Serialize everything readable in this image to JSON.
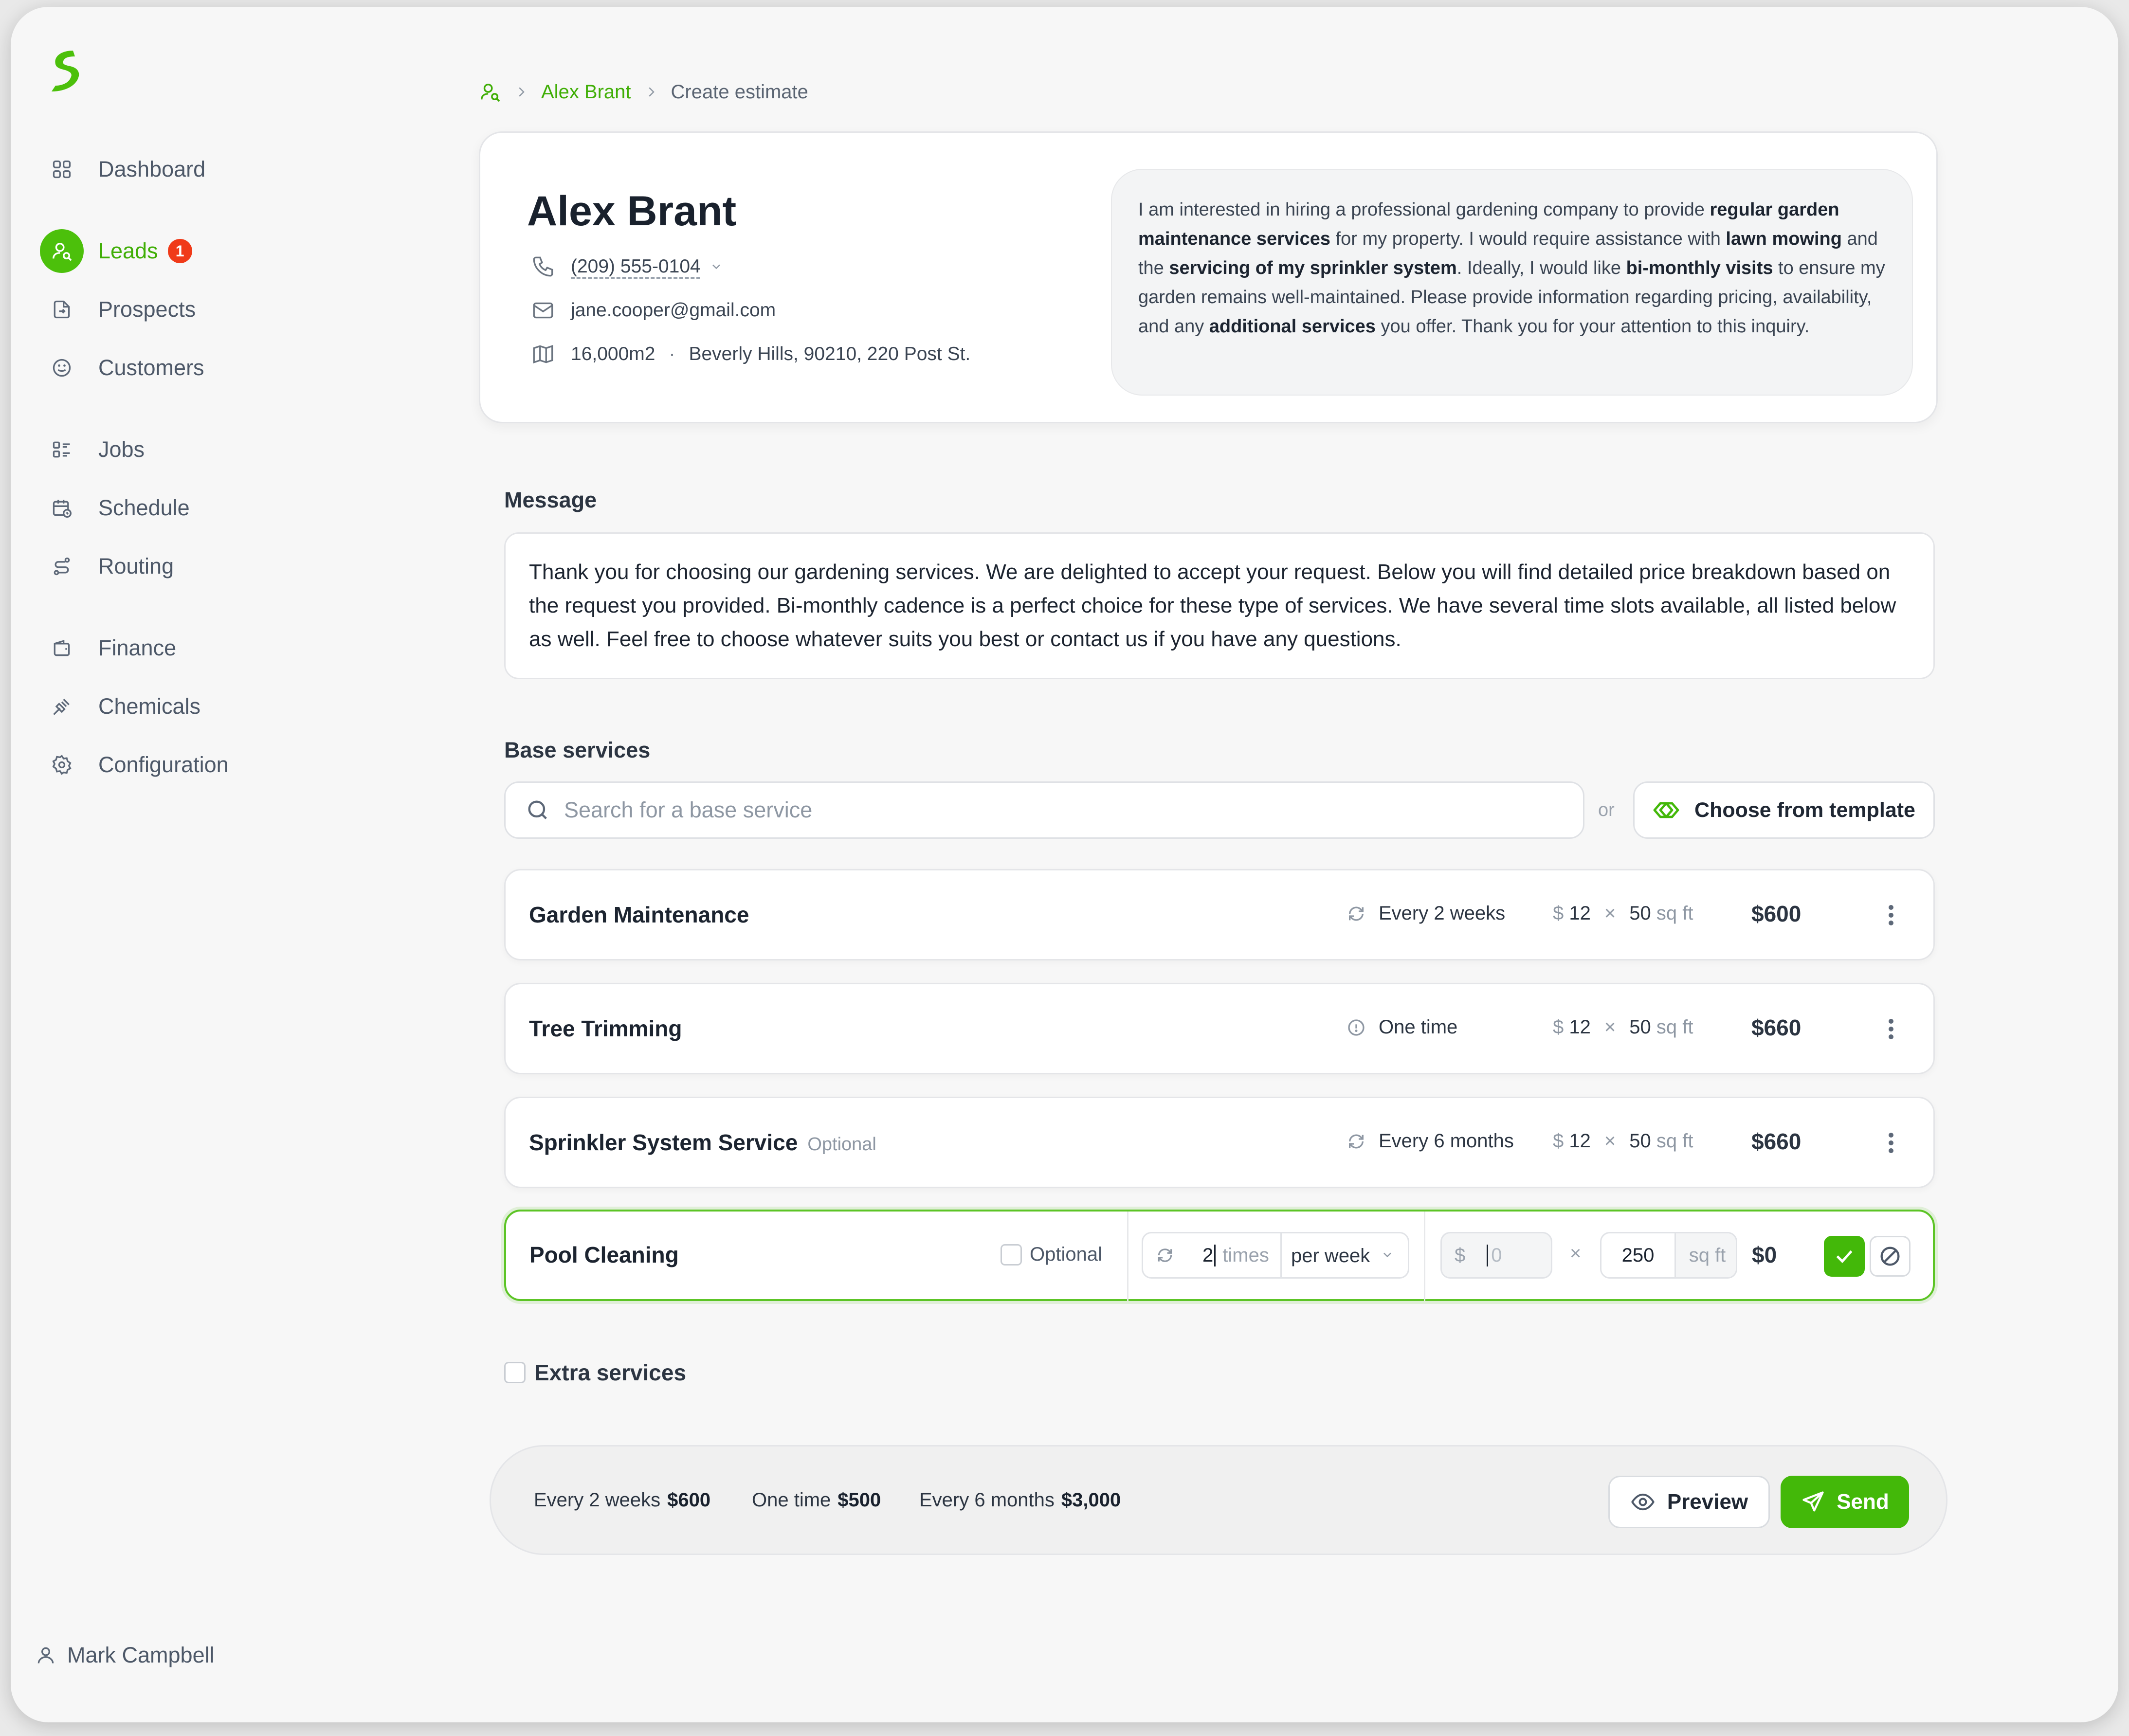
{
  "brand": {
    "accent": "#4cc00b",
    "badge_color": "#f03a19"
  },
  "sidebar": {
    "items": [
      {
        "label": "Dashboard",
        "icon": "grid-icon"
      },
      {
        "label": "Leads",
        "icon": "user-search-icon",
        "badge": "1",
        "active": true
      },
      {
        "label": "Prospects",
        "icon": "file-arrow-icon"
      },
      {
        "label": "Customers",
        "icon": "smiley-icon"
      },
      {
        "label": "Jobs",
        "icon": "list-icon"
      },
      {
        "label": "Schedule",
        "icon": "calendar-clock-icon"
      },
      {
        "label": "Routing",
        "icon": "route-icon"
      },
      {
        "label": "Finance",
        "icon": "wallet-icon"
      },
      {
        "label": "Chemicals",
        "icon": "spray-icon"
      },
      {
        "label": "Configuration",
        "icon": "gear-icon"
      }
    ],
    "user": "Mark Campbell"
  },
  "breadcrumb": {
    "parent": "Alex Brant",
    "current": "Create estimate"
  },
  "lead": {
    "name": "Alex Brant",
    "phone": "(209) 555-0104",
    "email": "jane.cooper@gmail.com",
    "area": "16,000m2",
    "address": "Beverly Hills, 90210, 220 Post St.",
    "request": [
      {
        "t": "I am interested in hiring a professional gardening company to provide "
      },
      {
        "t": "regular garden maintenance services",
        "b": true
      },
      {
        "t": " for my property. I would require assistance with "
      },
      {
        "t": "lawn mowing",
        "b": true
      },
      {
        "t": " and the "
      },
      {
        "t": "servicing of my sprinkler system",
        "b": true
      },
      {
        "t": ". Ideally, I would like "
      },
      {
        "t": "bi-monthly visits",
        "b": true
      },
      {
        "t": " to ensure my garden remains well-maintained. Please provide information regarding pricing, availability, and any "
      },
      {
        "t": "additional services",
        "b": true
      },
      {
        "t": " you offer. Thank you for your attention to this inquiry."
      }
    ]
  },
  "message": {
    "title": "Message",
    "body": "Thank you for choosing our gardening services. We are delighted to accept your request. Below you will find detailed price breakdown based on the request you provided. Bi-monthly cadence is a perfect choice for these type of services. We have several time slots available, all listed below as well. Feel free to choose whatever suits you best or contact us if you have any questions."
  },
  "base_services": {
    "title": "Base services",
    "search_placeholder": "Search for a base service",
    "or_label": "or",
    "template_button": "Choose from template",
    "rows": [
      {
        "name": "Garden Maintenance",
        "optional": "",
        "frequency": "Every 2 weeks",
        "freq_icon": "repeat-icon",
        "currency": "$",
        "rate": "12",
        "times": "×",
        "qty": "50",
        "unit": "sq ft",
        "total": "$600"
      },
      {
        "name": "Tree Trimming",
        "optional": "",
        "frequency": "One time",
        "freq_icon": "info-icon",
        "currency": "$",
        "rate": "12",
        "times": "×",
        "qty": "50",
        "unit": "sq ft",
        "total": "$660"
      },
      {
        "name": "Sprinkler System Service",
        "optional": "Optional",
        "frequency": "Every 6 months",
        "freq_icon": "repeat-icon",
        "currency": "$",
        "rate": "12",
        "times": "×",
        "qty": "50",
        "unit": "sq ft",
        "total": "$660"
      }
    ],
    "editing": {
      "name": "Pool Cleaning",
      "optional_label": "Optional",
      "count": "2",
      "times_label": "times",
      "period": "per week",
      "currency": "$",
      "rate_placeholder": "0",
      "mult": "×",
      "qty": "250",
      "unit": "sq ft",
      "total": "$0"
    }
  },
  "extra_services": {
    "label": "Extra services"
  },
  "summary": {
    "items": [
      {
        "label": "Every 2 weeks",
        "value": "$600"
      },
      {
        "label": "One time",
        "value": "$500"
      },
      {
        "label": "Every 6 months",
        "value": "$3,000"
      }
    ],
    "preview_label": "Preview",
    "send_label": "Send"
  }
}
